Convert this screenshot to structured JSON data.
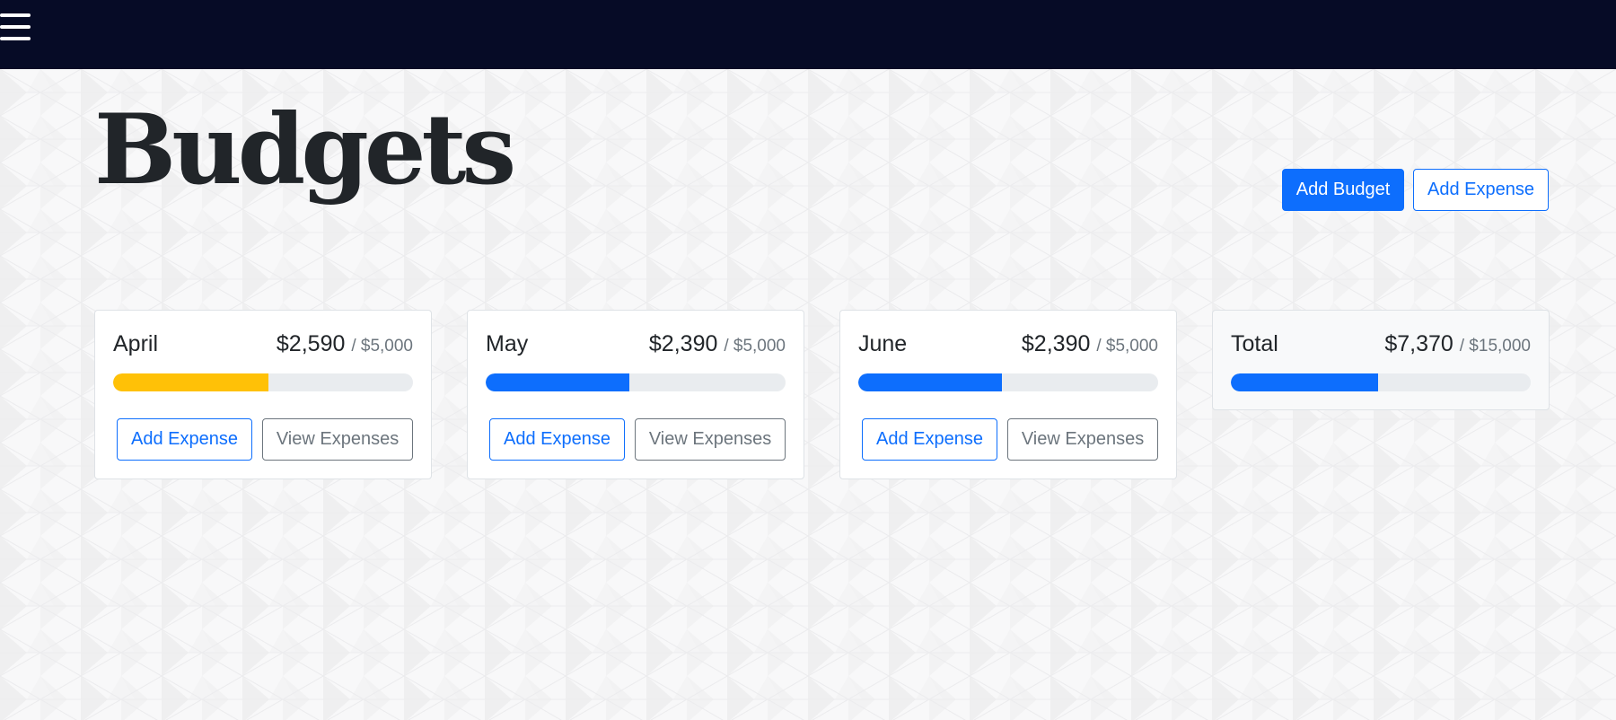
{
  "navbar": {
    "menu_icon": "hamburger-menu-icon"
  },
  "page": {
    "title": "Budgets"
  },
  "header_actions": {
    "add_budget_label": "Add Budget",
    "add_expense_label": "Add Expense"
  },
  "budgets": [
    {
      "name": "April",
      "spent": "$2,590",
      "max": "/ $5,000",
      "progress": 0.518,
      "bar_color": "#ffc107",
      "add_expense_label": "Add Expense",
      "view_expenses_label": "View Expenses"
    },
    {
      "name": "May",
      "spent": "$2,390",
      "max": "/ $5,000",
      "progress": 0.478,
      "bar_color": "#0d6efd",
      "add_expense_label": "Add Expense",
      "view_expenses_label": "View Expenses"
    },
    {
      "name": "June",
      "spent": "$2,390",
      "max": "/ $5,000",
      "progress": 0.478,
      "bar_color": "#0d6efd",
      "add_expense_label": "Add Expense",
      "view_expenses_label": "View Expenses"
    }
  ],
  "total": {
    "name": "Total",
    "spent": "$7,370",
    "max": "/ $15,000",
    "progress": 0.491,
    "bar_color": "#0d6efd"
  },
  "colors": {
    "navbar": "#060b26",
    "primary": "#0d6efd",
    "warning": "#ffc107",
    "secondary": "#6c757d"
  }
}
